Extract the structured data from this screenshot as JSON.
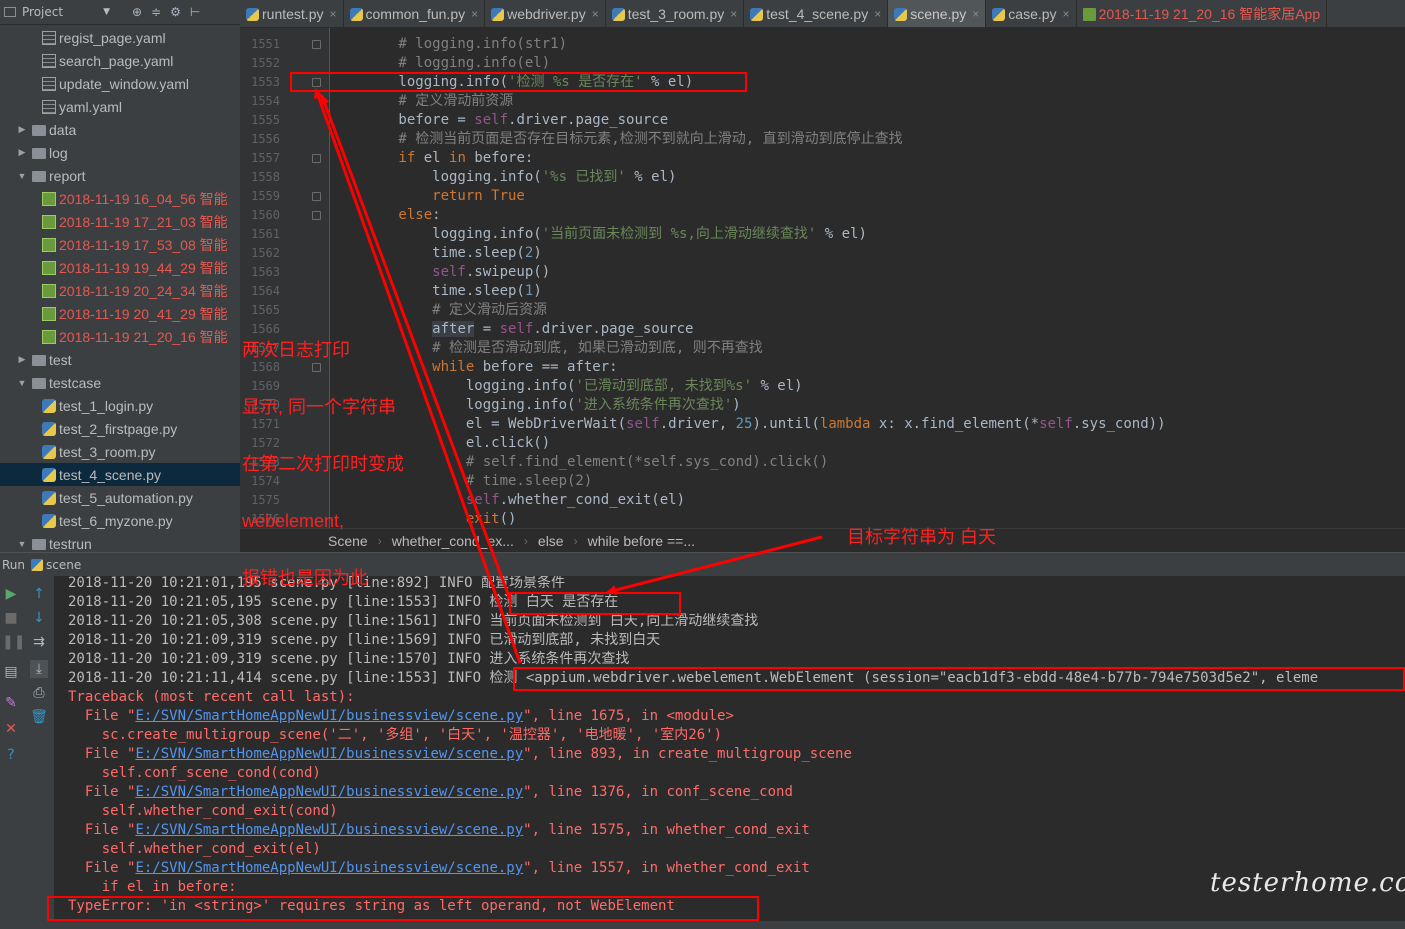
{
  "project": {
    "title": "Project",
    "items": [
      {
        "type": "yaml",
        "label": "regist_page.yaml",
        "indent": 3
      },
      {
        "type": "yaml",
        "label": "search_page.yaml",
        "indent": 3
      },
      {
        "type": "yaml",
        "label": "update_window.yaml",
        "indent": 3
      },
      {
        "type": "yaml",
        "label": "yaml.yaml",
        "indent": 3
      },
      {
        "type": "folder",
        "label": "data",
        "indent": 1,
        "arrow": "▶"
      },
      {
        "type": "folder",
        "label": "log",
        "indent": 1,
        "arrow": "▶"
      },
      {
        "type": "folder",
        "label": "report",
        "indent": 1,
        "arrow": "▼"
      },
      {
        "type": "html",
        "label": "2018-11-19 16_04_56 智能",
        "indent": 3,
        "red": true
      },
      {
        "type": "html",
        "label": "2018-11-19 17_21_03 智能",
        "indent": 3,
        "red": true
      },
      {
        "type": "html",
        "label": "2018-11-19 17_53_08 智能",
        "indent": 3,
        "red": true
      },
      {
        "type": "html",
        "label": "2018-11-19 19_44_29 智能",
        "indent": 3,
        "red": true
      },
      {
        "type": "html",
        "label": "2018-11-19 20_24_34 智能",
        "indent": 3,
        "red": true
      },
      {
        "type": "html",
        "label": "2018-11-19 20_41_29 智能",
        "indent": 3,
        "red": true
      },
      {
        "type": "html",
        "label": "2018-11-19 21_20_16 智能",
        "indent": 3,
        "red": true
      },
      {
        "type": "folder",
        "label": "test",
        "indent": 1,
        "arrow": "▶"
      },
      {
        "type": "folder",
        "label": "testcase",
        "indent": 1,
        "arrow": "▼"
      },
      {
        "type": "py",
        "label": "test_1_login.py",
        "indent": 3
      },
      {
        "type": "py",
        "label": "test_2_firstpage.py",
        "indent": 3
      },
      {
        "type": "py",
        "label": "test_3_room.py",
        "indent": 3
      },
      {
        "type": "py",
        "label": "test_4_scene.py",
        "indent": 3,
        "selected": true
      },
      {
        "type": "py",
        "label": "test_5_automation.py",
        "indent": 3
      },
      {
        "type": "py",
        "label": "test_6_myzone.py",
        "indent": 3
      },
      {
        "type": "folder",
        "label": "testrun",
        "indent": 1,
        "arrow": "▼"
      }
    ]
  },
  "tabs": [
    {
      "label": "runtest.py",
      "icon": "py"
    },
    {
      "label": "common_fun.py",
      "icon": "py"
    },
    {
      "label": "webdriver.py",
      "icon": "py"
    },
    {
      "label": "test_3_room.py",
      "icon": "py"
    },
    {
      "label": "test_4_scene.py",
      "icon": "py"
    },
    {
      "label": "scene.py",
      "icon": "py",
      "active": true
    },
    {
      "label": "case.py",
      "icon": "py"
    },
    {
      "label": "2018-11-19 21_20_16 智能家居App",
      "icon": "html",
      "red": true
    }
  ],
  "code": {
    "first_line": 1551,
    "lines": [
      [
        [
          "c-cmt",
          "        # logging.info(str1)"
        ]
      ],
      [
        [
          "c-cmt",
          "        # logging.info(el)"
        ]
      ],
      [
        [
          "",
          "        logging.info("
        ],
        [
          "c-str",
          "'检测 %s 是否存在'"
        ],
        [
          "",
          " % el)"
        ]
      ],
      [
        [
          "c-cmt",
          "        # 定义滑动前资源"
        ]
      ],
      [
        [
          "",
          "        before = "
        ],
        [
          "c-self",
          "self"
        ],
        [
          "",
          ".driver.page_source"
        ]
      ],
      [
        [
          "c-cmt",
          "        # 检测当前页面是否存在目标元素,检测不到就向上滑动, 直到滑动到底停止查找"
        ]
      ],
      [
        [
          "c-kw",
          "        if "
        ],
        [
          "",
          "el "
        ],
        [
          "c-kw",
          "in "
        ],
        [
          "",
          "before:"
        ]
      ],
      [
        [
          "",
          "            logging.info("
        ],
        [
          "c-str",
          "'%s 已找到'"
        ],
        [
          "",
          " % el)"
        ]
      ],
      [
        [
          "c-kw",
          "            return True"
        ]
      ],
      [
        [
          "c-kw",
          "        else"
        ],
        [
          "",
          ":"
        ]
      ],
      [
        [
          "",
          "            logging.info("
        ],
        [
          "c-str",
          "'当前页面未检测到 %s,向上滑动继续查找'"
        ],
        [
          "",
          " % el)"
        ]
      ],
      [
        [
          "",
          "            time.sleep("
        ],
        [
          "c-num",
          "2"
        ],
        [
          "",
          ")"
        ]
      ],
      [
        [
          "c-self",
          "            self"
        ],
        [
          "",
          ".swipeup()"
        ]
      ],
      [
        [
          "",
          "            time.sleep("
        ],
        [
          "c-num",
          "1"
        ],
        [
          "",
          ")"
        ]
      ],
      [
        [
          "c-cmt",
          "            # 定义滑动后资源"
        ]
      ],
      [
        [
          "",
          "            "
        ],
        [
          "c-hl",
          "after"
        ],
        [
          "",
          " = "
        ],
        [
          "c-self",
          "self"
        ],
        [
          "",
          ".driver.page_source"
        ]
      ],
      [
        [
          "c-cmt",
          "            # 检测是否滑动到底, 如果已滑动到底, 则不再查找"
        ]
      ],
      [
        [
          "c-kw",
          "            while "
        ],
        [
          "",
          "before == after:"
        ]
      ],
      [
        [
          "",
          "                logging.info("
        ],
        [
          "c-str",
          "'已滑动到底部, 未找到%s'"
        ],
        [
          "",
          " % el)"
        ]
      ],
      [
        [
          "",
          "                logging.info("
        ],
        [
          "c-str",
          "'进入系统条件再次查找'"
        ],
        [
          "",
          ")"
        ]
      ],
      [
        [
          "",
          "                el = WebDriverWait("
        ],
        [
          "c-self",
          "self"
        ],
        [
          "",
          ".driver, "
        ],
        [
          "c-num",
          "25"
        ],
        [
          "",
          ").until("
        ],
        [
          "c-kw",
          "lambda "
        ],
        [
          "",
          "x: x.find_element(*"
        ],
        [
          "c-self",
          "self"
        ],
        [
          "",
          ".sys_cond))"
        ]
      ],
      [
        [
          "",
          "                el.click()"
        ]
      ],
      [
        [
          "c-cmt",
          "                # self.find_element(*self.sys_cond).click()"
        ]
      ],
      [
        [
          "c-cmt",
          "                # time.sleep(2)"
        ]
      ],
      [
        [
          "c-self",
          "                self"
        ],
        [
          "",
          ".whether_cond_exit(el)"
        ]
      ],
      [
        [
          "c-kw",
          "                exit"
        ],
        [
          "",
          "()"
        ]
      ]
    ]
  },
  "breadcrumb": [
    "Scene",
    "whether_cond_ex...",
    "else",
    "while before ==..."
  ],
  "run": {
    "label": "Run",
    "config": "scene"
  },
  "console": [
    {
      "t": "2018-11-20 10:21:01,195 scene.py [line:892] INFO 配置场景条件",
      "cls": ""
    },
    {
      "t": "2018-11-20 10:21:05,195 scene.py [line:1553] INFO 检测 白天 是否存在",
      "cls": ""
    },
    {
      "t": "2018-11-20 10:21:05,308 scene.py [line:1561] INFO 当前页面未检测到 白天,向上滑动继续查找",
      "cls": ""
    },
    {
      "t": "2018-11-20 10:21:09,319 scene.py [line:1569] INFO 已滑动到底部, 未找到白天",
      "cls": ""
    },
    {
      "t": "2018-11-20 10:21:09,319 scene.py [line:1570] INFO 进入系统条件再次查找",
      "cls": ""
    },
    {
      "t": "2018-11-20 10:21:11,414 scene.py [line:1553] INFO 检测 <appium.webdriver.webelement.WebElement (session=\"eacb1df3-ebdd-48e4-b77b-794e7503d5e2\", eleme",
      "cls": ""
    },
    {
      "t": "Traceback (most recent call last):",
      "cls": "err"
    },
    {
      "pre": "  File \"",
      "link": "E:/SVN/SmartHomeAppNewUI/businessview/scene.py",
      "post": "\", line 1675, in <module>",
      "cls": "err"
    },
    {
      "t": "    sc.create_multigroup_scene('二', '多组', '白天', '温控器', '电地暖', '室内26')",
      "cls": "err"
    },
    {
      "pre": "  File \"",
      "link": "E:/SVN/SmartHomeAppNewUI/businessview/scene.py",
      "post": "\", line 893, in create_multigroup_scene",
      "cls": "err"
    },
    {
      "t": "    self.conf_scene_cond(cond)",
      "cls": "err"
    },
    {
      "pre": "  File \"",
      "link": "E:/SVN/SmartHomeAppNewUI/businessview/scene.py",
      "post": "\", line 1376, in conf_scene_cond",
      "cls": "err"
    },
    {
      "t": "    self.whether_cond_exit(cond)",
      "cls": "err"
    },
    {
      "pre": "  File \"",
      "link": "E:/SVN/SmartHomeAppNewUI/businessview/scene.py",
      "post": "\", line 1575, in whether_cond_exit",
      "cls": "err"
    },
    {
      "t": "    self.whether_cond_exit(el)",
      "cls": "err"
    },
    {
      "pre": "  File \"",
      "link": "E:/SVN/SmartHomeAppNewUI/businessview/scene.py",
      "post": "\", line 1557, in whether_cond_exit",
      "cls": "err"
    },
    {
      "t": "    if el in before:",
      "cls": "err"
    },
    {
      "t": "TypeError: 'in <string>' requires string as left operand, not WebElement",
      "cls": "err"
    }
  ],
  "annotations": {
    "note_left": [
      "两次日志打印",
      "显示, 同一个字符串",
      "在第二次打印时变成",
      "webelement,",
      "报错也是因为此"
    ],
    "note_right": "目标字符串为 白天",
    "color": "#ff0000"
  },
  "watermark": "testerhome.com"
}
